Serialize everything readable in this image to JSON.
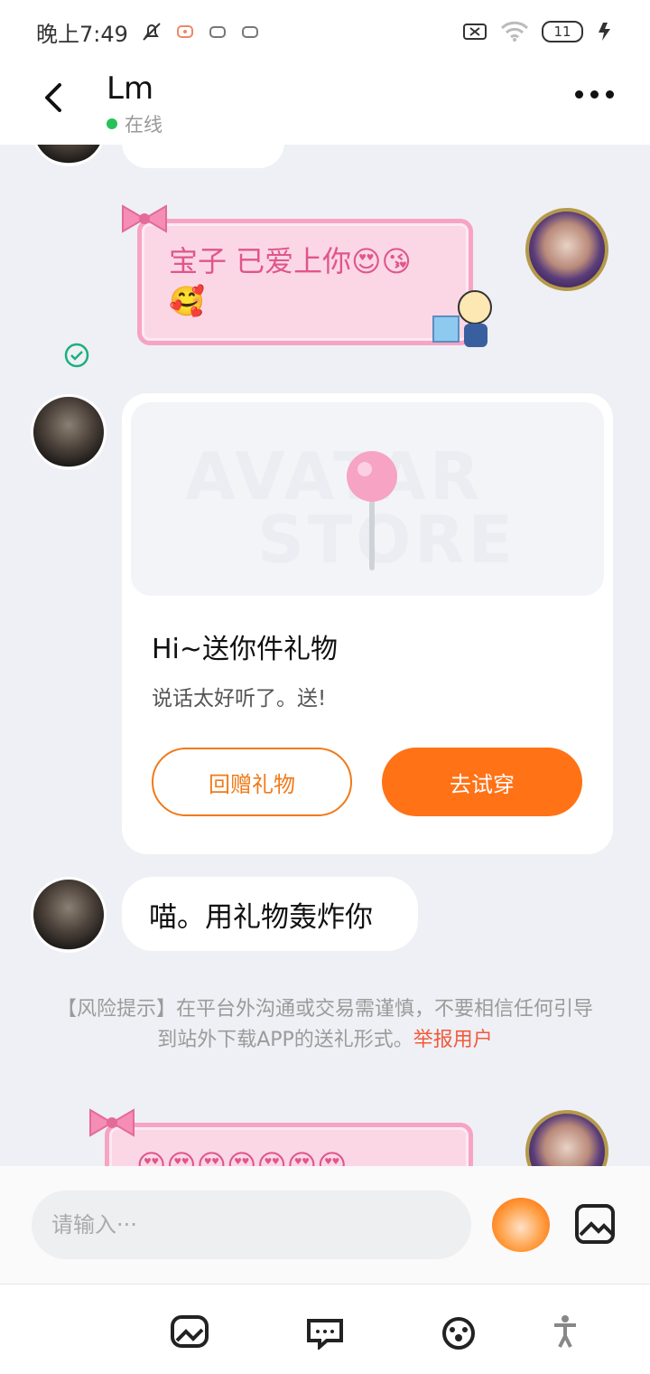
{
  "status_bar": {
    "time": "晚上7:49",
    "battery": "11",
    "icons": [
      "bell-off-icon",
      "notification-icon",
      "notification-icon",
      "notification-icon",
      "sim-off-icon",
      "wifi-icon",
      "battery-icon",
      "charging-icon"
    ]
  },
  "header": {
    "name": "Lm",
    "status": "在线",
    "status_color": "#27c15b"
  },
  "messages": {
    "msg1": "宝子 已爱上你😍😘🥰",
    "gift_card": {
      "title": "Hi~送你件礼物",
      "subtitle": "说话太好听了。送!",
      "btn_return": "回赠礼物",
      "btn_tryon": "去试穿",
      "watermark_line1": "AVATAR",
      "watermark_line2": "STORE"
    },
    "msg2": "喵。用礼物轰炸你",
    "msg3": "😍😍😍😍😍😍😍"
  },
  "risk_notice": {
    "text": "【风险提示】在平台外沟通或交易需谨慎，不要相信任何引导到站外下载APP的送礼形式。",
    "report_link": "举报用户"
  },
  "input": {
    "placeholder": "请输入···"
  },
  "colors": {
    "accent_orange": "#ff7216",
    "pink_bubble": "#fbd7e6",
    "pink_text": "#e0568a",
    "report_red": "#f25a3c"
  },
  "bottom_nav": [
    "image-icon",
    "chat-bubble-icon",
    "paw-icon",
    "person-icon"
  ]
}
